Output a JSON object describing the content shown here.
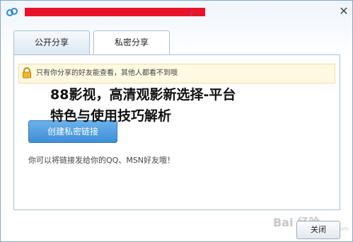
{
  "titlebar": {
    "tail_text": "/",
    "close_glyph": "✕",
    "app_icon": "share-cloud-icon"
  },
  "tabs": [
    {
      "label": "公开分享"
    },
    {
      "label": "私密分享"
    }
  ],
  "notice": {
    "icon": "lock-icon",
    "text": "只有你分享的好友能查看，其他人都看不到哦"
  },
  "overlay": {
    "line1": "88影视，高清观影新选择-平台",
    "line2": "特色与使用技巧解析"
  },
  "main": {
    "create_button": "创建私密链接",
    "hint": "你可以将链接发给你的QQ、MSN好友哦！"
  },
  "watermark": {
    "text": "Bai 经验",
    "sub": "jingyan.baidu.com"
  },
  "footer": {
    "close_button": "关闭"
  },
  "colors": {
    "accent": "#4a9be0",
    "redaction": "#e8132a",
    "notice_bg": "#fff9e2",
    "border": "#a9bfd6"
  }
}
